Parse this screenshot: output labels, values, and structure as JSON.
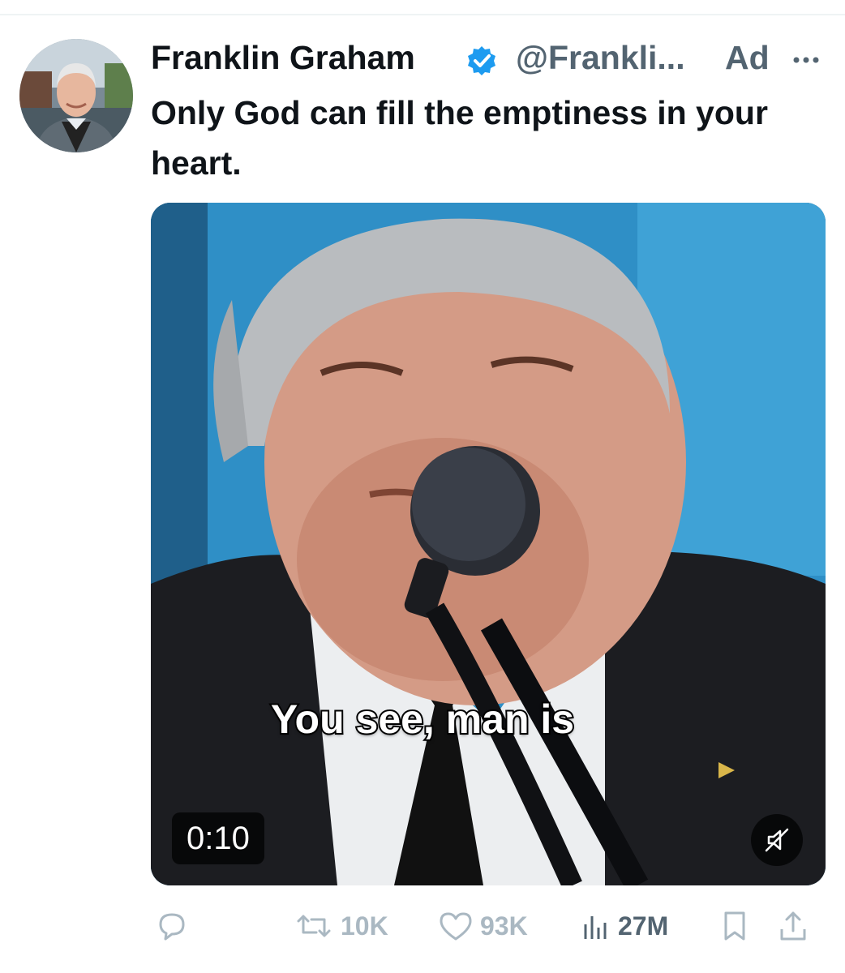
{
  "author": {
    "display_name": "Franklin Graham",
    "handle": "@Frankli...",
    "verified": true,
    "ad_label": "Ad"
  },
  "tweet": {
    "text": "Only God can fill the emptiness in your heart."
  },
  "media": {
    "type": "video",
    "caption": "You see, man is",
    "duration": "0:10",
    "muted": true
  },
  "actions": {
    "replies": "",
    "retweets": "10K",
    "likes": "93K",
    "views": "27M"
  },
  "icons": {
    "verified": "verified-badge-icon",
    "more": "more-icon",
    "reply": "reply-icon",
    "retweet": "retweet-icon",
    "like": "heart-icon",
    "views": "views-icon",
    "bookmark": "bookmark-icon",
    "share": "share-icon",
    "mute": "mute-icon"
  },
  "colors": {
    "verified_blue": "#1d9bf0",
    "text_primary": "#0f1419",
    "text_secondary": "#536471",
    "action_gray": "#aab8c2"
  }
}
